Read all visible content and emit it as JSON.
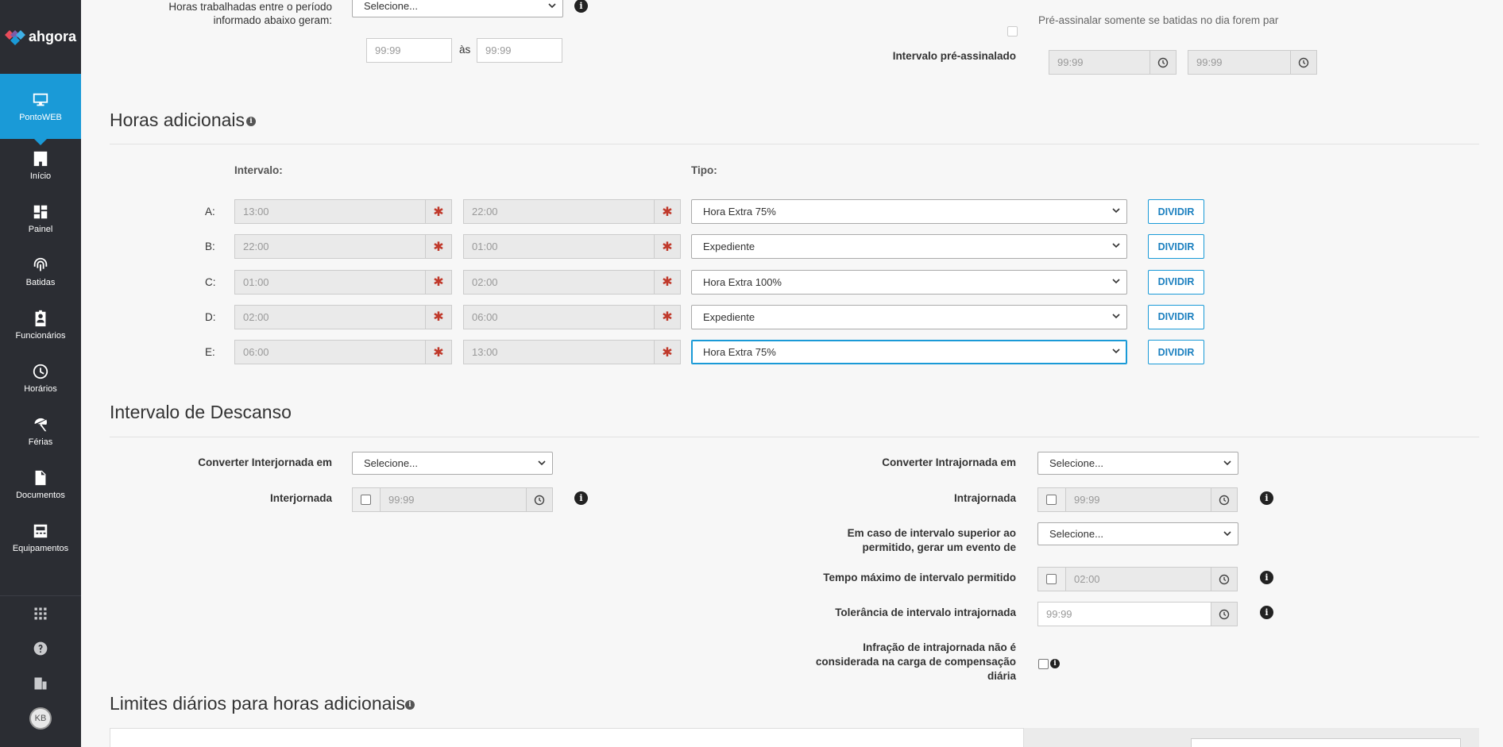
{
  "brand": {
    "name": "ahgora"
  },
  "sidebar": {
    "items": [
      {
        "label": "PontoWEB",
        "icon": "monitor-icon",
        "active": true
      },
      {
        "label": "Início",
        "icon": "home-icon"
      },
      {
        "label": "Painel",
        "icon": "dashboard-icon"
      },
      {
        "label": "Batidas",
        "icon": "fingerprint-icon"
      },
      {
        "label": "Funcionários",
        "icon": "badge-icon"
      },
      {
        "label": "Horários",
        "icon": "clock-icon"
      },
      {
        "label": "Férias",
        "icon": "beach-umbrella-icon"
      },
      {
        "label": "Documentos",
        "icon": "document-icon"
      },
      {
        "label": "Equipamentos",
        "icon": "device-icon"
      }
    ],
    "bottom": [
      "apps-grid-icon",
      "help-icon",
      "building-icon"
    ],
    "avatar_initials": "KB"
  },
  "top": {
    "worked_hours_label": "Horas trabalhadas entre o período informado abaixo geram:",
    "worked_hours_select": "Selecione...",
    "from_placeholder": "99:99",
    "between_label": "às",
    "to_placeholder": "99:99",
    "presign_checkbox_label": "Pré-assinalar somente se batidas no dia forem par",
    "presign_interval_label": "Intervalo pré-assinalado",
    "presign_from": "99:99",
    "presign_to": "99:99"
  },
  "horas_adicionais": {
    "title": "Horas adicionais",
    "col_intervalo": "Intervalo:",
    "col_tipo": "Tipo:",
    "divide_label": "DIVIDIR",
    "rows": [
      {
        "letter": "A:",
        "start": "13:00",
        "end": "22:00",
        "tipo": "Hora Extra 75%"
      },
      {
        "letter": "B:",
        "start": "22:00",
        "end": "01:00",
        "tipo": "Expediente"
      },
      {
        "letter": "C:",
        "start": "01:00",
        "end": "02:00",
        "tipo": "Hora Extra 100%"
      },
      {
        "letter": "D:",
        "start": "02:00",
        "end": "06:00",
        "tipo": "Expediente"
      },
      {
        "letter": "E:",
        "start": "06:00",
        "end": "13:00",
        "tipo": "Hora Extra 75%"
      }
    ]
  },
  "descanso": {
    "title": "Intervalo de Descanso",
    "converter_inter_label": "Converter Interjornada em",
    "converter_inter_value": "Selecione...",
    "interjornada_label": "Interjornada",
    "interjornada_value": "99:99",
    "converter_intra_label": "Converter Intrajornada em",
    "converter_intra_value": "Selecione...",
    "intrajornada_label": "Intrajornada",
    "intrajornada_value": "99:99",
    "superior_label_1": "Em caso de intervalo superior ao",
    "superior_label_2": "permitido, gerar um evento de",
    "superior_value": "Selecione...",
    "tempo_max_label": "Tempo máximo de intervalo permitido",
    "tempo_max_value": "02:00",
    "tolerancia_label": "Tolerância de intervalo intrajornada",
    "tolerancia_value": "99:99",
    "infracao_label_1": "Infração de intrajornada não é",
    "infracao_label_2": "considerada na carga de compensação",
    "infracao_label_3": "diária"
  },
  "limites": {
    "title": "Limites diários para horas adicionais"
  },
  "colors": {
    "accent": "#1a9ad7",
    "sidebar": "#2b2d33",
    "required": "#c0392b"
  }
}
